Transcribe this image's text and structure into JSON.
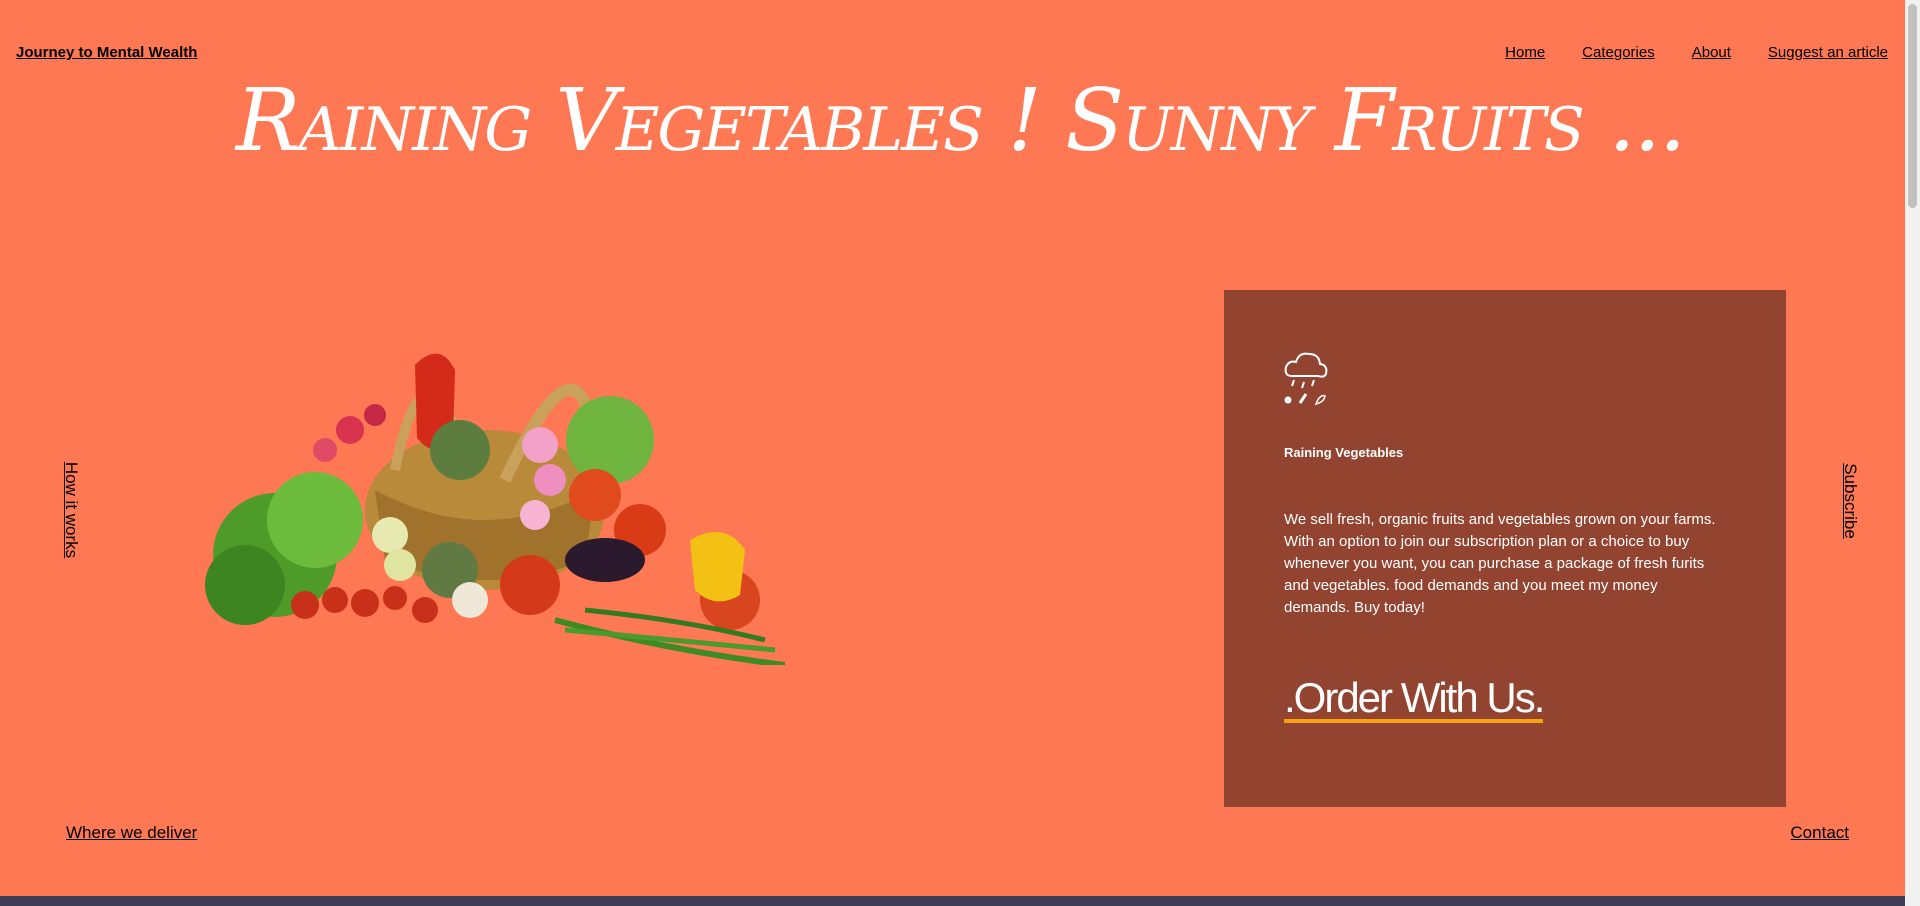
{
  "header": {
    "brand": "Journey to Mental Wealth",
    "nav": [
      "Home",
      "Categories",
      "About",
      "Suggest an article"
    ]
  },
  "hero": {
    "title": "Raining Vegetables ! Sunny Fruits ..."
  },
  "side": {
    "left_link": "How it works",
    "right_link": "Subscribe"
  },
  "card": {
    "icon": "cloud-rain-produce-icon",
    "title": "Raining Vegetables",
    "description": "We sell fresh, organic fruits and vegetables grown on your farms. With an option to join our subscription plan or a choice to buy whenever you want, you can purchase a package of fresh furits and vegetables. food demands and you meet my money demands. Buy today!",
    "cta": ".Order With Us."
  },
  "footer": {
    "left_link": "Where we deliver",
    "right_link": "Contact"
  },
  "colors": {
    "background": "#fe7853",
    "card": "#924431",
    "accent_underline": "#f6a313",
    "bottom_bar": "#3e3d55"
  }
}
